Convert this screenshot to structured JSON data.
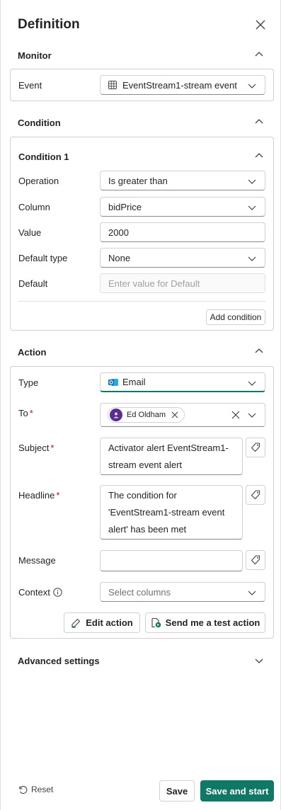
{
  "panel": {
    "title": "Definition"
  },
  "monitor": {
    "heading": "Monitor",
    "event_label": "Event",
    "event_value": "EventStream1-stream event"
  },
  "condition": {
    "heading": "Condition",
    "subheading": "Condition 1",
    "operation_label": "Operation",
    "operation_value": "Is greater than",
    "column_label": "Column",
    "column_value": "bidPrice",
    "value_label": "Value",
    "value_value": "2000",
    "default_type_label": "Default type",
    "default_type_value": "None",
    "default_label": "Default",
    "default_placeholder": "Enter value for Default",
    "add_button": "Add condition"
  },
  "action": {
    "heading": "Action",
    "type_label": "Type",
    "type_value": "Email",
    "to_label": "To",
    "to_recipient": "Ed Oldham",
    "subject_label": "Subject",
    "subject_line1": "Activator alert EventStream1-",
    "subject_line2": "stream event alert",
    "headline_label": "Headline",
    "headline_line1": "The condition for",
    "headline_line2": "'EventStream1-stream event",
    "headline_line3": "alert' has been met",
    "message_label": "Message",
    "message_value": "",
    "context_label": "Context",
    "context_placeholder": "Select columns",
    "edit_button": "Edit action",
    "test_button": "Send me a test action",
    "required_mark": "*"
  },
  "advanced": {
    "heading": "Advanced settings"
  },
  "footer": {
    "reset_label": "Reset",
    "save_label": "Save",
    "save_start_label": "Save and start"
  },
  "colors": {
    "accent": "#117865",
    "required": "#c50f1f",
    "outlook_blue": "#0f6cbd",
    "avatar": "#5c2d91"
  }
}
